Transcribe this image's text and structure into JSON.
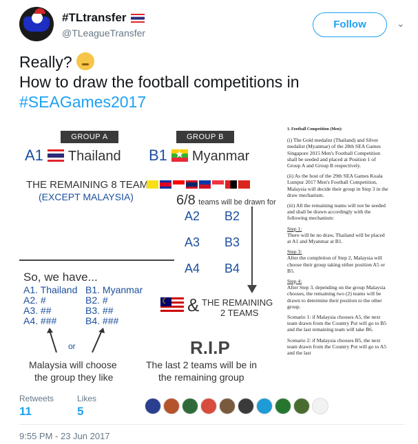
{
  "user": {
    "display_name": "#TLtransfer",
    "handle": "@TLeagueTransfer",
    "follow_label": "Follow"
  },
  "tweet": {
    "line1": "Really?",
    "line2": "How to draw the football competitions in",
    "hashtag": "#SEAGames2017"
  },
  "image": {
    "group_a_header": "GROUP A",
    "group_b_header": "GROUP B",
    "a1": "A1",
    "a1_team": "Thailand",
    "b1": "B1",
    "b1_team": "Myanmar",
    "remaining_line1": "THE REMAINING 8 TEAMS",
    "remaining_line2": "(EXCEPT MALAYSIA)",
    "drawn_big": "6/8",
    "drawn_small": "teams will be drawn for",
    "slots": [
      "A2",
      "B2",
      "A3",
      "B3",
      "A4",
      "B4"
    ],
    "so_we_have": "So, we have...",
    "list_a": [
      "A1. Thailand",
      "A2. #",
      "A3. ##",
      "A4. ###"
    ],
    "list_b": [
      "B1. Myanmar",
      "B2. #",
      "B3. ##",
      "B4. ###"
    ],
    "or_label": "or",
    "malaysia_line1": "Malaysia will choose",
    "malaysia_line2": "the group they like",
    "amp": "&",
    "remaining2_line1": "THE REMAINING",
    "remaining2_line2": "2 TEAMS",
    "rip": "R.I.P",
    "last2_line1": "The last 2 teams will be in",
    "last2_line2": "the remaining group",
    "doc_heading": "1. Football Competition (Men):",
    "doc_paragraphs": [
      "(i)    The Gold medalist (Thailand) and Silver medalist (Myanmar) of the 28th SEA Games Singapore 2015 Men's Football Competition shall be seeded and placed at Position 1 of Group A and Group B respectively.",
      "(ii)   As the host of the 29th SEA Games Kuala Lumpur 2017 Men's Football Competition, Malaysia will decide their group in Step 3 in the draw mechanism.",
      "(iii)  All the remaining teams will not be seeded and shall be drawn accordingly with the following mechanism:"
    ],
    "step1_title": "Step 1:",
    "step1_text": "There will be no draw, Thailand will be placed at A1 and Myanmar at B1.",
    "step3_title": "Step 3:",
    "step3_text": "After the completion of Step 2, Malaysia will choose their group taking either position A5 or B5.",
    "step4_title": "Step 4:",
    "step4_text": "After Step 3, depending on the group Malaysia chooses, the remaining two (2) teams will be drawn to determine their position to the other group.",
    "scenario1": "Scenario 1: if Malaysia chooses A5, the next team drawn from the Country Pot will go to B5 and the last remaining team will take B6.",
    "scenario2": "Scenario 2: if Malaysia chooses B5, the next team drawn from the Country Pot will go to A5 and the last"
  },
  "stats": {
    "retweets_label": "Retweets",
    "retweets_count": "11",
    "likes_label": "Likes",
    "likes_count": "5",
    "liker_avatar_colors": [
      "#2a3f8f",
      "#b5532c",
      "#2f6b3a",
      "#d94b3d",
      "#7a5a3c",
      "#3a3a3a",
      "#1f9bd6",
      "#26762f",
      "#4a6b2f",
      "#f2f2f2"
    ]
  },
  "timestamp": "9:55 PM - 23 Jun 2017",
  "colors": {
    "accent": "#1da1f2",
    "text": "#14171a",
    "muted": "#657786"
  }
}
